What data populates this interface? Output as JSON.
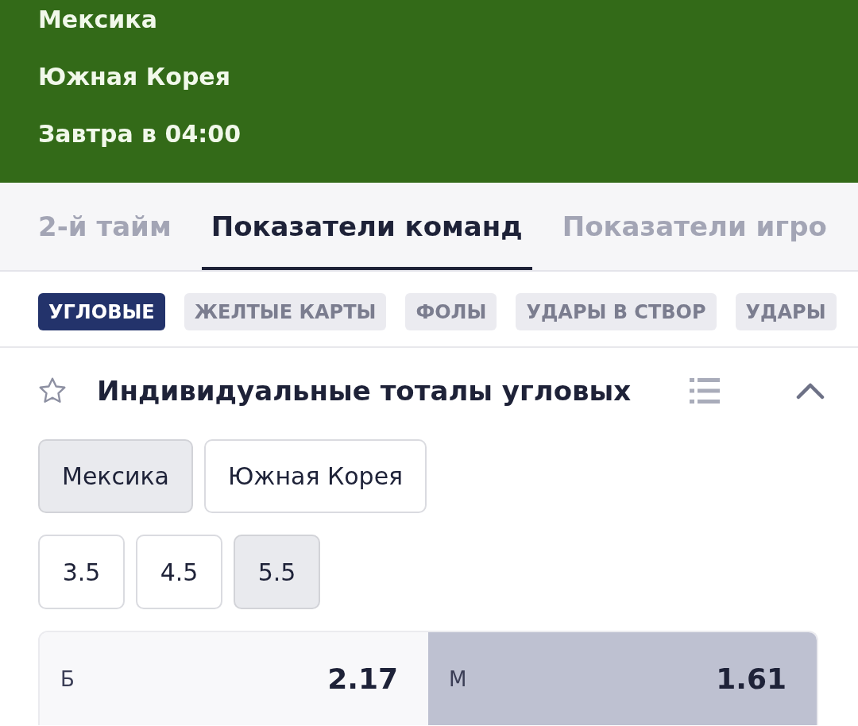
{
  "match": {
    "teams": [
      "Мексика",
      "Южная Корея"
    ],
    "start_time": "Завтра в 04:00"
  },
  "tabs": [
    {
      "label": "2-й тайм",
      "selected": false
    },
    {
      "label": "Показатели команд",
      "selected": true
    },
    {
      "label": "Показатели игро",
      "selected": false
    }
  ],
  "categories": [
    {
      "label": "УГЛОВЫЕ",
      "selected": true
    },
    {
      "label": "ЖЕЛТЫЕ КАРТЫ",
      "selected": false
    },
    {
      "label": "ФОЛЫ",
      "selected": false
    },
    {
      "label": "УДАРЫ В СТВОР",
      "selected": false
    },
    {
      "label": "УДАРЫ",
      "selected": false
    }
  ],
  "market": {
    "title": "Индивидуальные тоталы угловых",
    "favorite": false,
    "expanded": true,
    "teams": [
      {
        "label": "Мексика",
        "selected": true
      },
      {
        "label": "Южная Корея",
        "selected": false
      }
    ],
    "lines": [
      {
        "label": "3.5",
        "selected": false
      },
      {
        "label": "4.5",
        "selected": false
      },
      {
        "label": "5.5",
        "selected": true
      }
    ],
    "outcomes": [
      {
        "label": "Б",
        "odds": "2.17",
        "selected": false
      },
      {
        "label": "М",
        "odds": "1.61",
        "selected": true
      }
    ]
  }
}
